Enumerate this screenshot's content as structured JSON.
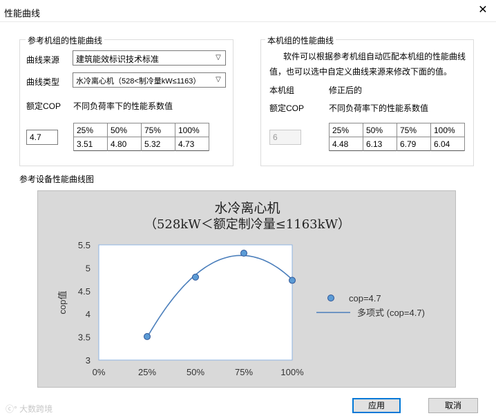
{
  "window": {
    "title": "性能曲线",
    "close_glyph": "✕"
  },
  "ref_group": {
    "title": "参考机组的性能曲线",
    "source_label": "曲线来源",
    "source_value": "建筑能效标识技术标准",
    "type_label": "曲线类型",
    "type_value": "水冷离心机（528<制冷量kW≤1163）",
    "cop_label": "额定COP",
    "coef_label": "不同负荷率下的性能系数值",
    "cop_value": "4.7",
    "loads": [
      "25%",
      "50%",
      "75%",
      "100%"
    ],
    "values": [
      "3.51",
      "4.80",
      "5.32",
      "4.73"
    ]
  },
  "own_group": {
    "title": "本机组的性能曲线",
    "desc_line1": "软件可以根据参考机组自动匹配本机组的性能曲线",
    "desc_line2": "值，也可以选中自定义曲线来源来修改下面的值。",
    "unit_label": "本机组",
    "corrected_label": "修正后的",
    "cop_label": "额定COP",
    "coef_label": "不同负荷率下的性能系数值",
    "cop_value": "6",
    "loads": [
      "25%",
      "50%",
      "75%",
      "100%"
    ],
    "values": [
      "4.48",
      "6.13",
      "6.79",
      "6.04"
    ]
  },
  "chart_section_label": "参考设备性能曲线图",
  "chart_data": {
    "type": "scatter",
    "title": "水冷离心机",
    "subtitle": "（528kW＜额定制冷量≤1163kW）",
    "xlabel": "",
    "ylabel": "cop值",
    "x_tick_labels": [
      "0%",
      "25%",
      "50%",
      "75%",
      "100%"
    ],
    "y_tick_labels": [
      "3",
      "3.5",
      "4",
      "4.5",
      "5",
      "5.5"
    ],
    "xlim": [
      0,
      1
    ],
    "ylim": [
      3,
      5.5
    ],
    "series": [
      {
        "name": "cop=4.7",
        "kind": "points",
        "x": [
          0.25,
          0.5,
          0.75,
          1.0
        ],
        "y": [
          3.51,
          4.8,
          5.32,
          4.73
        ]
      },
      {
        "name": "多项式 (cop=4.7)",
        "kind": "trendline"
      }
    ],
    "legend_position": "right",
    "grid": false,
    "colors": {
      "marker_fill": "#5b9bd5",
      "line": "#4a7ebb",
      "plot_bg": "#ffffff",
      "axis": "#8eb4e3"
    }
  },
  "buttons": {
    "apply": "应用",
    "cancel": "取消"
  },
  "watermark": "大数跨境"
}
